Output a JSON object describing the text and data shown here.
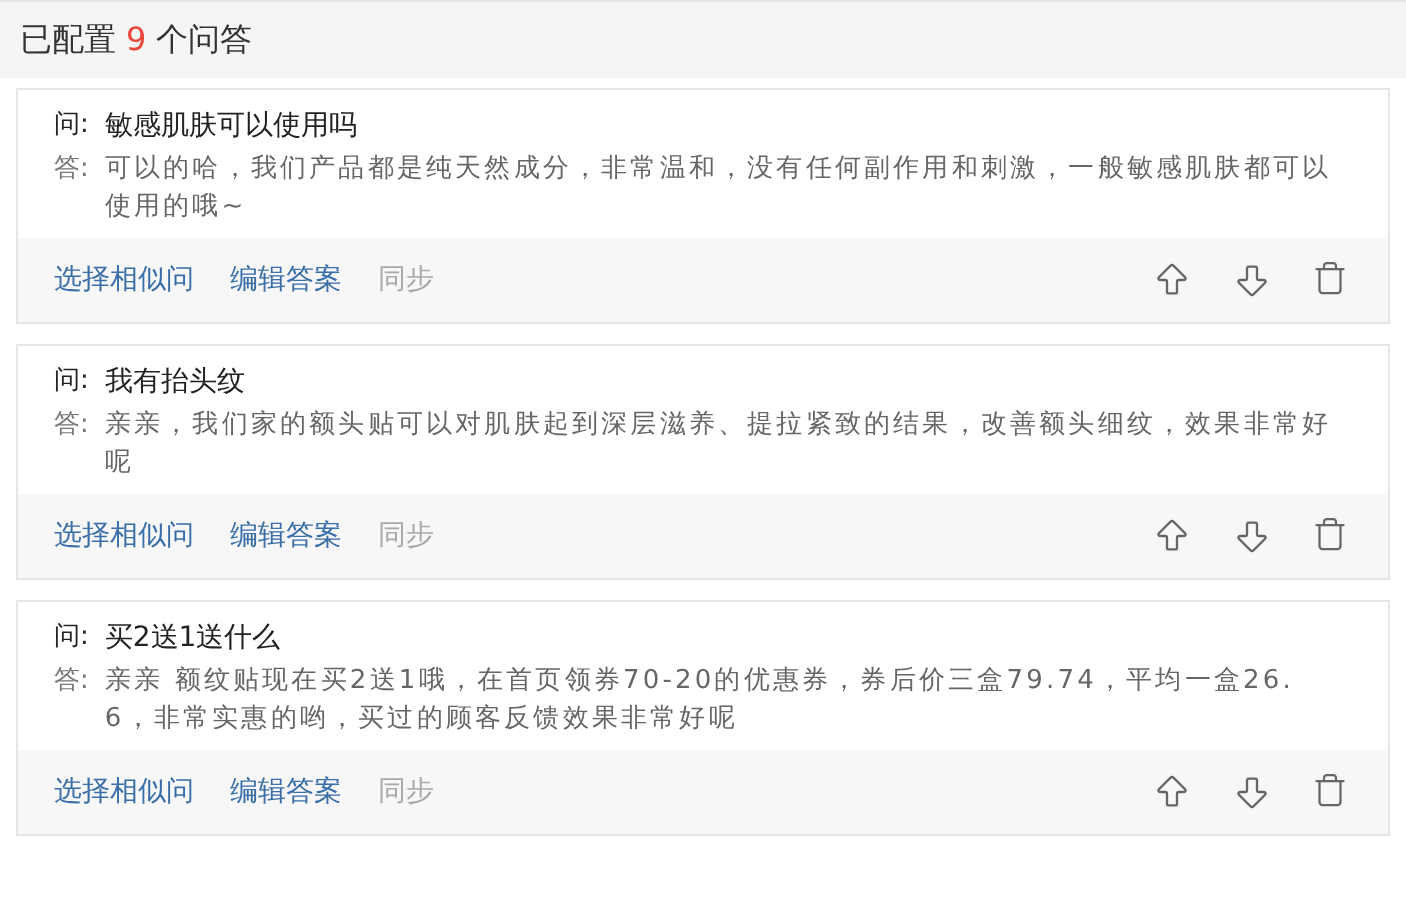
{
  "header": {
    "prefix": "已配置",
    "count": "9",
    "suffix": "个问答"
  },
  "items": [
    {
      "q_label": "问:",
      "question": "敏感肌肤可以使用吗",
      "a_label": "答:",
      "answer": "可以的哈，我们产品都是纯天然成分，非常温和，没有任何副作用和刺激，一般敏感肌肤都可以使用的哦~",
      "actions": [
        {
          "label": "选择相似问",
          "disabled": false
        },
        {
          "label": "编辑答案",
          "disabled": false
        },
        {
          "label": "同步",
          "disabled": true
        }
      ]
    },
    {
      "q_label": "问:",
      "question": "我有抬头纹",
      "a_label": "答:",
      "answer": "亲亲，我们家的额头贴可以对肌肤起到深层滋养、提拉紧致的结果，改善额头细纹，效果非常好呢",
      "actions": [
        {
          "label": "选择相似问",
          "disabled": false
        },
        {
          "label": "编辑答案",
          "disabled": false
        },
        {
          "label": "同步",
          "disabled": true
        }
      ]
    },
    {
      "q_label": "问:",
      "question": "买2送1送什么",
      "a_label": "答:",
      "answer": "亲亲 额纹贴现在买2送1哦，在首页领券70-20的优惠券，券后价三盒79.74，平均一盒26.6，非常实惠的哟，买过的顾客反馈效果非常好呢",
      "actions": [
        {
          "label": "选择相似问",
          "disabled": false
        },
        {
          "label": "编辑答案",
          "disabled": false
        },
        {
          "label": "同步",
          "disabled": true
        }
      ]
    }
  ]
}
